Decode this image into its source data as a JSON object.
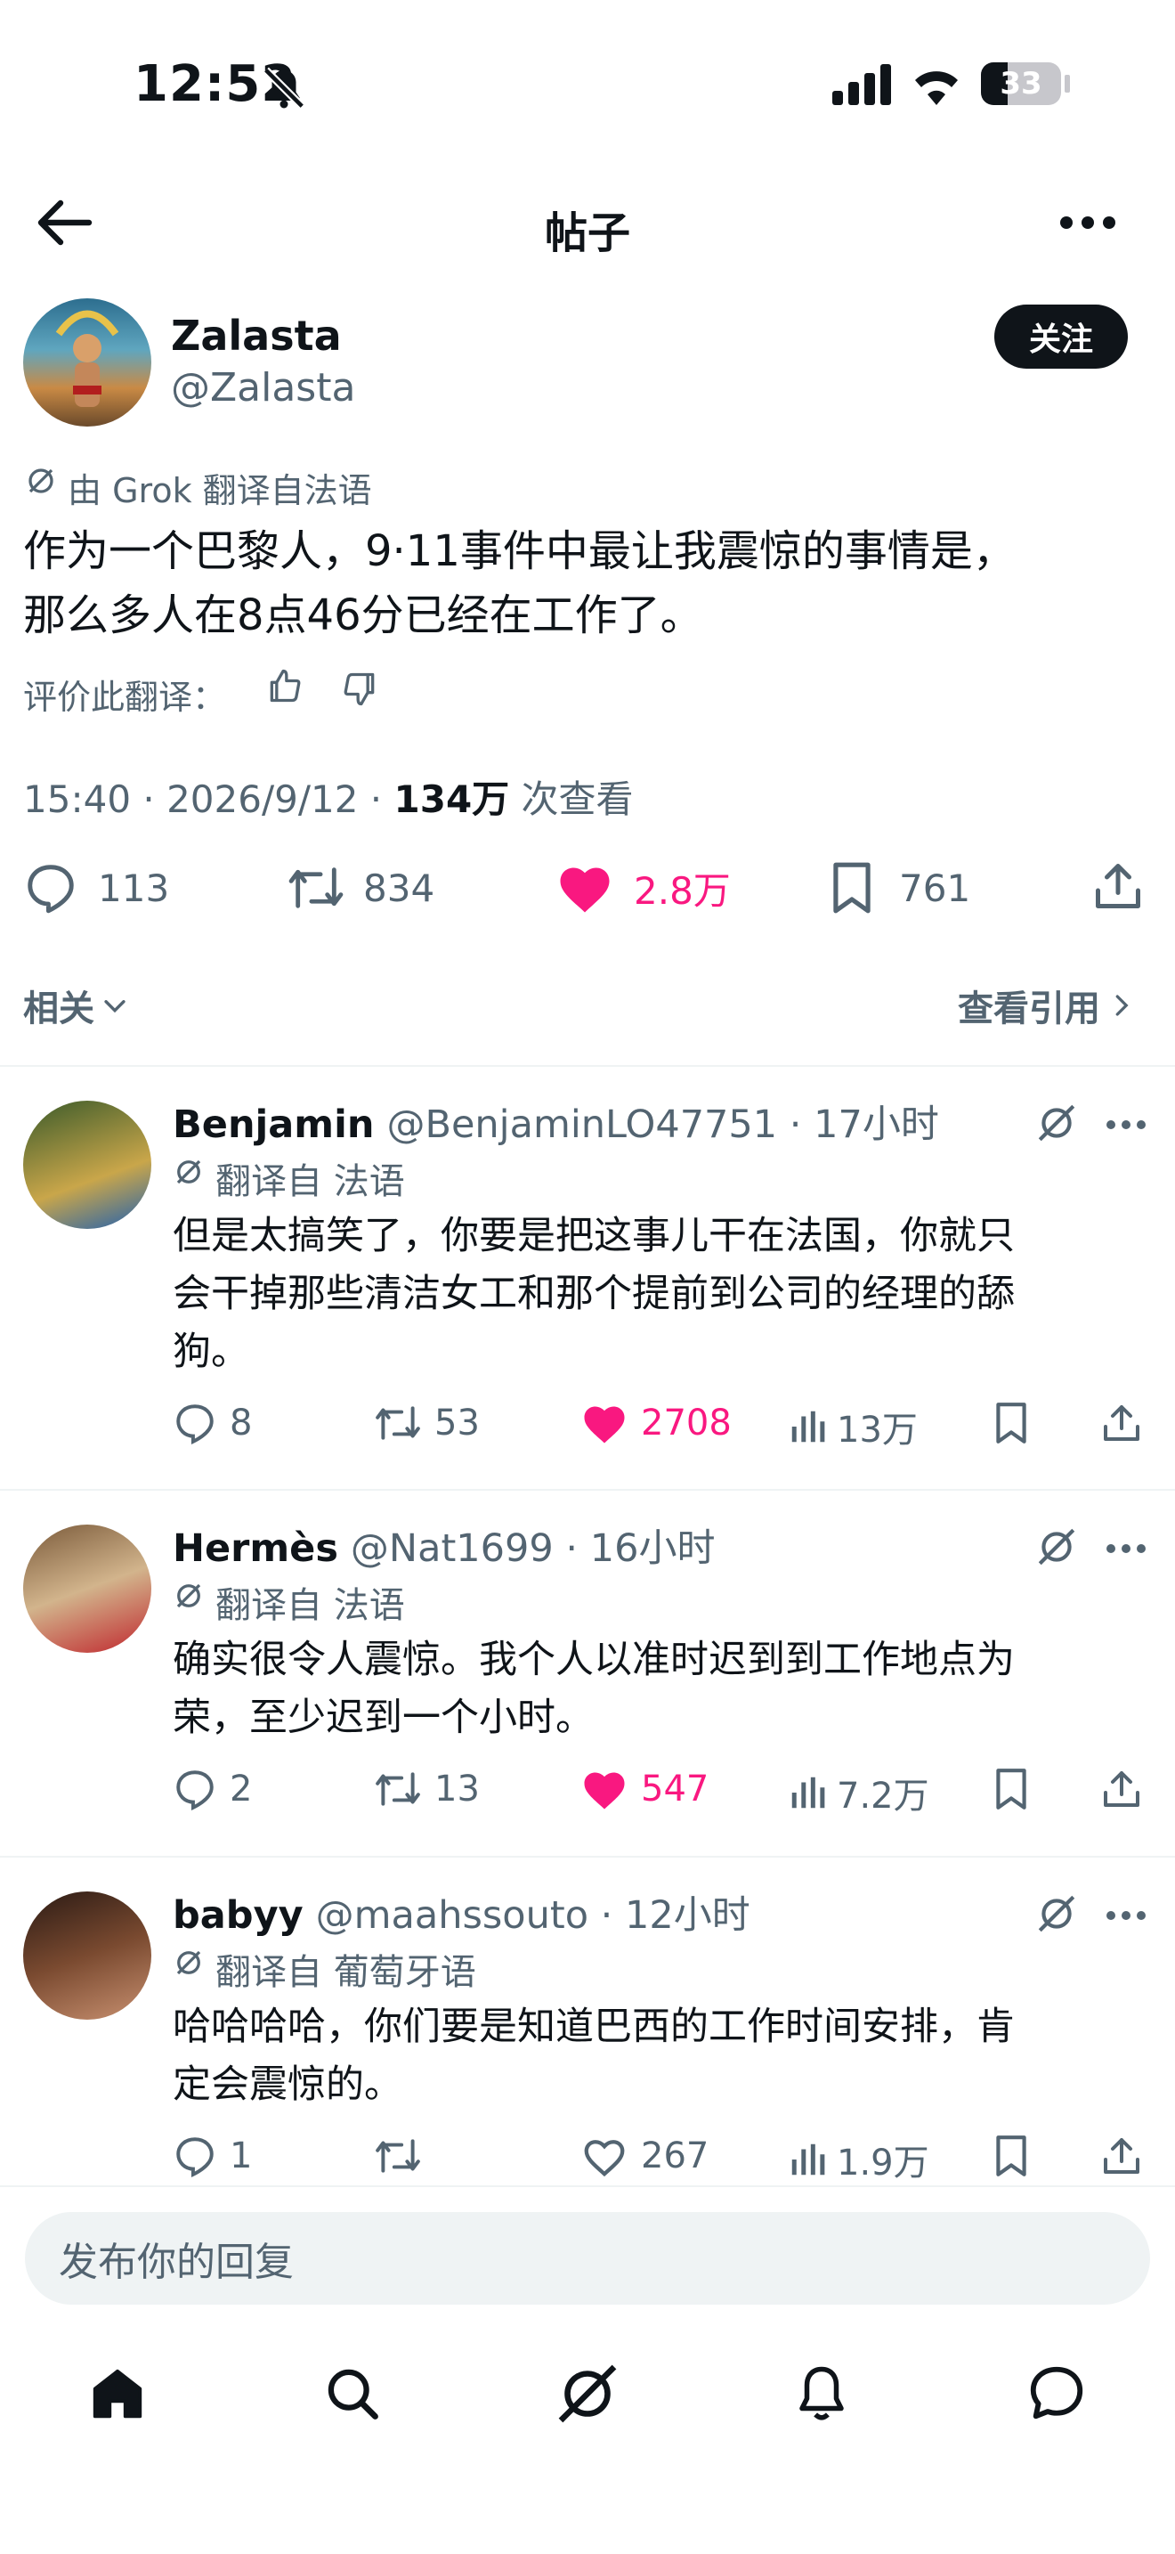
{
  "status_bar": {
    "time": "12:52",
    "battery": "33"
  },
  "nav": {
    "title": "帖子"
  },
  "post": {
    "display_name": "Zalasta",
    "handle": "@Zalasta",
    "follow_label": "关注",
    "translation_note": "由 Grok 翻译自法语",
    "text_line1": "作为一个巴黎人，9·11事件中最让我震惊的事情是，",
    "text_line2": "那么多人在8点46分已经在工作了。",
    "rate_translation": "评价此翻译：",
    "timestamp": "15:40 · 2026/9/12 · ",
    "views_count": "134万",
    "views_label": " 次查看",
    "stats": {
      "replies": "113",
      "reposts": "834",
      "likes": "2.8万",
      "bookmarks": "761"
    },
    "related_label": "相关",
    "view_quotes_label": "查看引用"
  },
  "replies": [
    {
      "name": "Benjamin",
      "meta": "@BenjaminLO47751 · 17小时",
      "translation": "翻译自 法语",
      "lines": [
        "但是太搞笑了，你要是把这事儿干在法国，你就只",
        "会干掉那些清洁女工和那个提前到公司的经理的舔",
        "狗。"
      ],
      "replies": "8",
      "reposts": "53",
      "likes": "2708",
      "views": "13万",
      "liked": true
    },
    {
      "name": "Hermès",
      "meta": "@Nat1699 · 16小时",
      "translation": "翻译自 法语",
      "lines": [
        "确实很令人震惊。我个人以准时迟到到工作地点为",
        "荣，至少迟到一个小时。"
      ],
      "replies": "2",
      "reposts": "13",
      "likes": "547",
      "views": "7.2万",
      "liked": true
    },
    {
      "name": "babyy",
      "meta": "@maahssouto · 12小时",
      "translation": "翻译自 葡萄牙语",
      "lines": [
        "哈哈哈哈，你们要是知道巴西的工作时间安排，肯",
        "定会震惊的。"
      ],
      "replies": "1",
      "reposts": "",
      "likes": "267",
      "views": "1.9万",
      "liked": false
    }
  ],
  "composer": {
    "placeholder": "发布你的回复"
  },
  "colors": {
    "like_pink": "#f91880",
    "text": "#0f1419",
    "muted": "#536471",
    "divider": "#eff3f4"
  }
}
